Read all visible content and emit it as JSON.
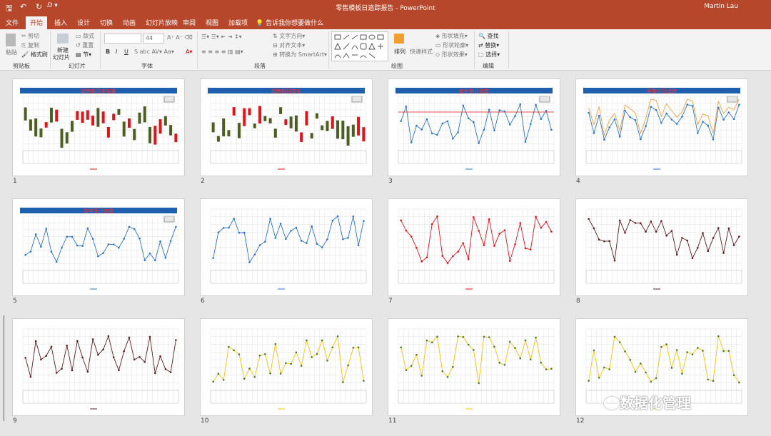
{
  "window": {
    "title": "零售模板日追踪报告 - PowerPoint",
    "user": "Martin Lau",
    "quick_access": [
      "save-icon",
      "undo-icon",
      "redo-icon",
      "customize-icon"
    ]
  },
  "tabs": [
    "文件",
    "开始",
    "插入",
    "设计",
    "切换",
    "动画",
    "幻灯片放映",
    "审阅",
    "视图",
    "加载项"
  ],
  "active_tab": "开始",
  "tell_me": "告诉我你想要做什么",
  "ribbon": {
    "clipboard": {
      "paste": "粘贴",
      "cut": "剪切",
      "copy": "复制",
      "format_painter": "格式刷",
      "label": "剪贴板"
    },
    "slides": {
      "new_slide": "新建",
      "new_slide2": "幻灯片",
      "layout": "版式",
      "reset": "重置",
      "section": "节",
      "label": "幻灯片"
    },
    "font": {
      "size": "44",
      "label": "字体"
    },
    "paragraph": {
      "text_direction": "文字方向",
      "align_text": "对齐文本",
      "smartart": "转换为 SmartArt",
      "label": "段落"
    },
    "drawing": {
      "arrange": "排列",
      "quick_styles": "快速样式",
      "shape_fill": "形状填充",
      "shape_outline": "形状轮廓",
      "shape_effects": "形状效果",
      "label": "绘图"
    },
    "editing": {
      "find": "查找",
      "replace": "替换",
      "select": "选择",
      "label": "编辑"
    }
  },
  "slides": [
    {
      "num": "1",
      "kind": "candle",
      "title": "销售额日变化量"
    },
    {
      "num": "2",
      "kind": "candle",
      "title": "销售额日变化"
    },
    {
      "num": "3",
      "kind": "line",
      "title": "销售额日追踪"
    },
    {
      "num": "4",
      "kind": "line2",
      "title": "客单价日追踪"
    },
    {
      "num": "5",
      "kind": "line",
      "title": "连带率日追踪"
    },
    {
      "num": "6",
      "kind": "line",
      "title": ""
    },
    {
      "num": "7",
      "kind": "line",
      "title": ""
    },
    {
      "num": "8",
      "kind": "line",
      "title": ""
    },
    {
      "num": "9",
      "kind": "line",
      "title": ""
    },
    {
      "num": "10",
      "kind": "line",
      "title": ""
    },
    {
      "num": "11",
      "kind": "line",
      "title": ""
    },
    {
      "num": "12",
      "kind": "line",
      "title": ""
    }
  ],
  "colors": {
    "accent": "#b7472a",
    "header_blue": "#1f5fb0",
    "up": "#e0121a",
    "down": "#4d5e22",
    "line_blue": "#2e75c4",
    "line_red": "#e0121a",
    "line_yellow": "#f2c40e",
    "line_dark": "#5a1f1f"
  },
  "watermark": "数据化管理"
}
